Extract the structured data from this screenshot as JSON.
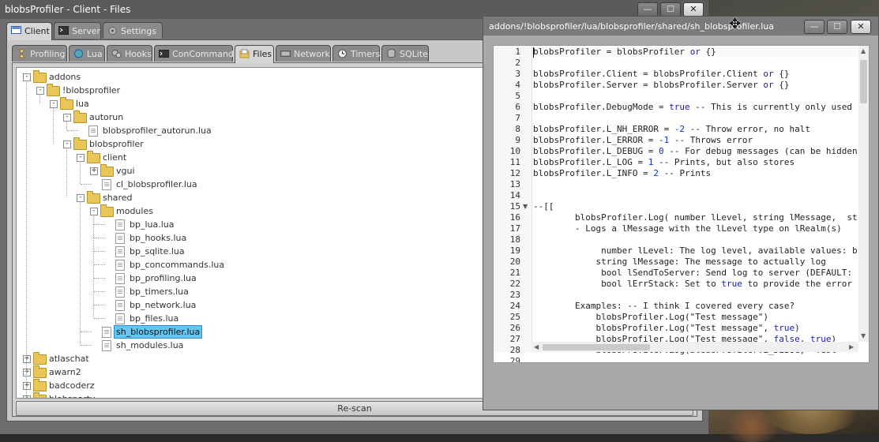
{
  "main_window": {
    "title": "blobsProfiler - Client - Files",
    "controls": {
      "minimize": "—",
      "maximize": "☐",
      "close": "✕"
    }
  },
  "realm_tabs": [
    {
      "label": "Client",
      "icon": "monitor-icon",
      "active": true
    },
    {
      "label": "Server",
      "icon": "terminal-icon",
      "active": false
    },
    {
      "label": "Settings",
      "icon": "gear-icon",
      "active": false
    }
  ],
  "module_tabs": [
    {
      "label": "Profiling",
      "icon": "hourglass-icon",
      "active": false
    },
    {
      "label": "Lua",
      "icon": "globe-icon",
      "active": false
    },
    {
      "label": "Hooks",
      "icon": "cogs-icon",
      "active": false
    },
    {
      "label": "ConCommands",
      "icon": "console-icon",
      "active": false
    },
    {
      "label": "Files",
      "icon": "files-icon",
      "active": true
    },
    {
      "label": "Network",
      "icon": "network-icon",
      "active": false
    },
    {
      "label": "Timers",
      "icon": "clock-icon",
      "active": false
    },
    {
      "label": "SQLite",
      "icon": "database-icon",
      "active": false
    }
  ],
  "tree": [
    {
      "label": "addons",
      "type": "folder",
      "expander": "-"
    },
    {
      "label": "!blobsprofiler",
      "type": "folder",
      "expander": "-"
    },
    {
      "label": "lua",
      "type": "folder",
      "expander": "-"
    },
    {
      "label": "autorun",
      "type": "folder",
      "expander": "-"
    },
    {
      "label": "blobsprofiler_autorun.lua",
      "type": "file"
    },
    {
      "label": "blobsprofiler",
      "type": "folder",
      "expander": "-"
    },
    {
      "label": "client",
      "type": "folder",
      "expander": "-"
    },
    {
      "label": "vgui",
      "type": "folder",
      "expander": "+"
    },
    {
      "label": "cl_blobsprofiler.lua",
      "type": "file"
    },
    {
      "label": "shared",
      "type": "folder",
      "expander": "-"
    },
    {
      "label": "modules",
      "type": "folder",
      "expander": "-"
    },
    {
      "label": "bp_lua.lua",
      "type": "file"
    },
    {
      "label": "bp_hooks.lua",
      "type": "file"
    },
    {
      "label": "bp_sqlite.lua",
      "type": "file"
    },
    {
      "label": "bp_concommands.lua",
      "type": "file"
    },
    {
      "label": "bp_profiling.lua",
      "type": "file"
    },
    {
      "label": "bp_timers.lua",
      "type": "file"
    },
    {
      "label": "bp_network.lua",
      "type": "file"
    },
    {
      "label": "bp_files.lua",
      "type": "file"
    },
    {
      "label": "sh_blobsprofiler.lua",
      "type": "file",
      "selected": true
    },
    {
      "label": "sh_modules.lua",
      "type": "file"
    },
    {
      "label": "atlaschat",
      "type": "folder",
      "expander": "+"
    },
    {
      "label": "awarn2",
      "type": "folder",
      "expander": "+"
    },
    {
      "label": "badcoderz",
      "type": "folder",
      "expander": "+"
    },
    {
      "label": "blobsparty",
      "type": "folder",
      "expander": "+"
    }
  ],
  "rescan_label": "Re-scan",
  "editor_window": {
    "title": "addons/!blobsprofiler/lua/blobsprofiler/shared/sh_blobsprofiler.lua",
    "controls": {
      "minimize": "—",
      "maximize": "☐",
      "close": "✕"
    }
  },
  "code_lines": [
    "blobsProfiler = blobsProfiler or {}",
    "",
    "blobsProfiler.Client = blobsProfiler.Client or {}",
    "blobsProfiler.Server = blobsProfiler.Server or {}",
    "",
    "blobsProfiler.DebugMode = true -- This is currently only used",
    "",
    "blobsProfiler.L_NH_ERROR = -2 -- Throw error, no halt",
    "blobsProfiler.L_ERROR = -1 -- Throws error",
    "blobsProfiler.L_DEBUG = 0 -- For debug messages (can be hidden",
    "blobsProfiler.L_LOG = 1 -- Prints, but also stores",
    "blobsProfiler.L_INFO = 2 -- Prints",
    "",
    "",
    "--[[",
    "        blobsProfiler.Log( number lLevel, string lMessage,  st",
    "        - Logs a lMessage with the lLevel type on lRealm(s)",
    "",
    "             number lLevel: The log level, available values: b",
    "            string lMessage: The message to actually log",
    "             bool lSendToServer: Send log to server (DEFAULT:",
    "             bool lErrStack: Set to true to provide the error",
    "",
    "        Examples: -- I think I covered every case?",
    "            blobsProfiler.Log(\"Test message\")",
    "            blobsProfiler.Log(\"Test message\", true)",
    "            blobsProfiler.Log(\"Test message\", false, true)",
    "            blobsProfiler.Log(blobsProfiler.L_DEBUG, \"Test",
    ""
  ],
  "fold_marker_line": 15
}
